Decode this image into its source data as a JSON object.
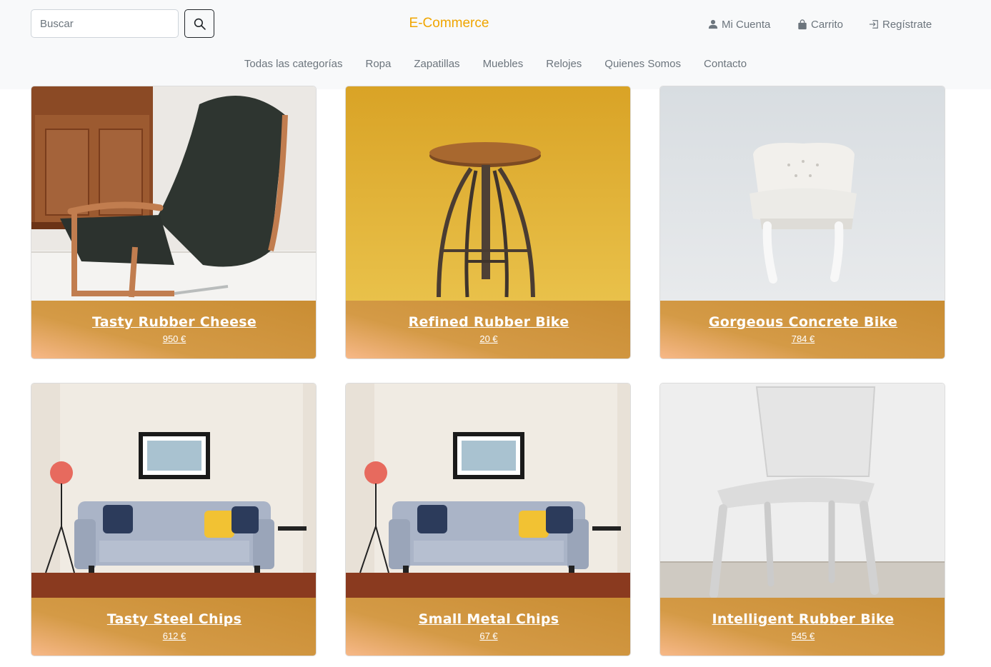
{
  "header": {
    "search": {
      "placeholder": "Buscar",
      "value": ""
    },
    "brand": "E-Commerce",
    "account_label": "Mi Cuenta",
    "cart_label": "Carrito",
    "register_label": "Regístrate",
    "colors": {
      "brand": "#f0a500",
      "background": "#f8f9fa"
    }
  },
  "nav": {
    "items": [
      "Todas las categorías",
      "Ropa",
      "Zapatillas",
      "Muebles",
      "Relojes",
      "Quienes Somos",
      "Contacto"
    ]
  },
  "products": [
    {
      "name": "Tasty Rubber Cheese",
      "price": "950 €",
      "image": "black armchair"
    },
    {
      "name": "Refined Rubber Bike",
      "price": "20 €",
      "image": "wooden stool on yellow"
    },
    {
      "name": "Gorgeous Concrete Bike",
      "price": "784 €",
      "image": "white tufted chair"
    },
    {
      "name": "Tasty Steel Chips",
      "price": "612 €",
      "image": "grey sofa living room"
    },
    {
      "name": "Small Metal Chips",
      "price": "67 €",
      "image": "grey sofa living room"
    },
    {
      "name": "Intelligent Rubber Bike",
      "price": "545 €",
      "image": "white plastic chair"
    }
  ]
}
